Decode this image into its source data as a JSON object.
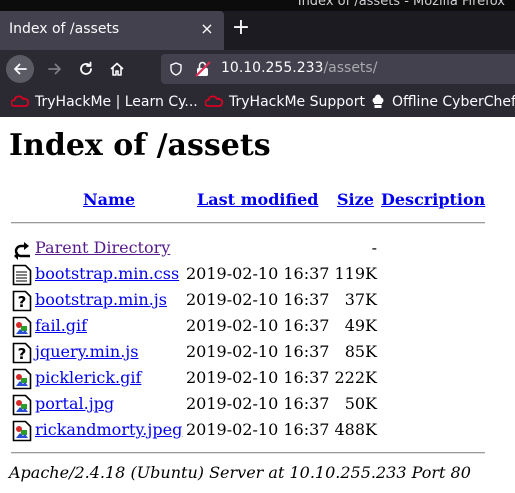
{
  "window": {
    "title": "Index of /assets - Mozilla Firefox"
  },
  "tab": {
    "title": "Index of /assets",
    "close_label": "×",
    "new_tab_label": "+"
  },
  "urlbar": {
    "host": "10.10.255.233",
    "path": "/assets/"
  },
  "bookmarks": [
    {
      "label": "TryHackMe | Learn Cy...",
      "icon": "tryhackme-icon"
    },
    {
      "label": "TryHackMe Support",
      "icon": "tryhackme-icon"
    },
    {
      "label": "Offline CyberChef",
      "icon": "cyberchef-icon"
    }
  ],
  "page": {
    "heading": "Index of /assets",
    "columns": {
      "name": "Name",
      "modified": "Last modified",
      "size": "Size",
      "description": "Description"
    },
    "parent": {
      "name": "Parent Directory",
      "size": "-"
    },
    "files": [
      {
        "name": "bootstrap.min.css",
        "modified": "2019-02-10 16:37",
        "size": "119K",
        "icon": "text-file-icon"
      },
      {
        "name": "bootstrap.min.js",
        "modified": "2019-02-10 16:37",
        "size": "37K",
        "icon": "unknown-file-icon"
      },
      {
        "name": "fail.gif",
        "modified": "2019-02-10 16:37",
        "size": "49K",
        "icon": "image-file-icon"
      },
      {
        "name": "jquery.min.js",
        "modified": "2019-02-10 16:37",
        "size": "85K",
        "icon": "unknown-file-icon"
      },
      {
        "name": "picklerick.gif",
        "modified": "2019-02-10 16:37",
        "size": "222K",
        "icon": "image-file-icon"
      },
      {
        "name": "portal.jpg",
        "modified": "2019-02-10 16:37",
        "size": "50K",
        "icon": "image-file-icon"
      },
      {
        "name": "rickandmorty.jpeg",
        "modified": "2019-02-10 16:37",
        "size": "488K",
        "icon": "image-file-icon"
      }
    ],
    "address": "Apache/2.4.18 (Ubuntu) Server at 10.10.255.233 Port 80"
  },
  "colors": {
    "link": "#0000ee",
    "visited": "#551a8b",
    "toolbar": "#2b2a33",
    "tab_active": "#42414d",
    "bookmark_icon": "#d70022"
  }
}
